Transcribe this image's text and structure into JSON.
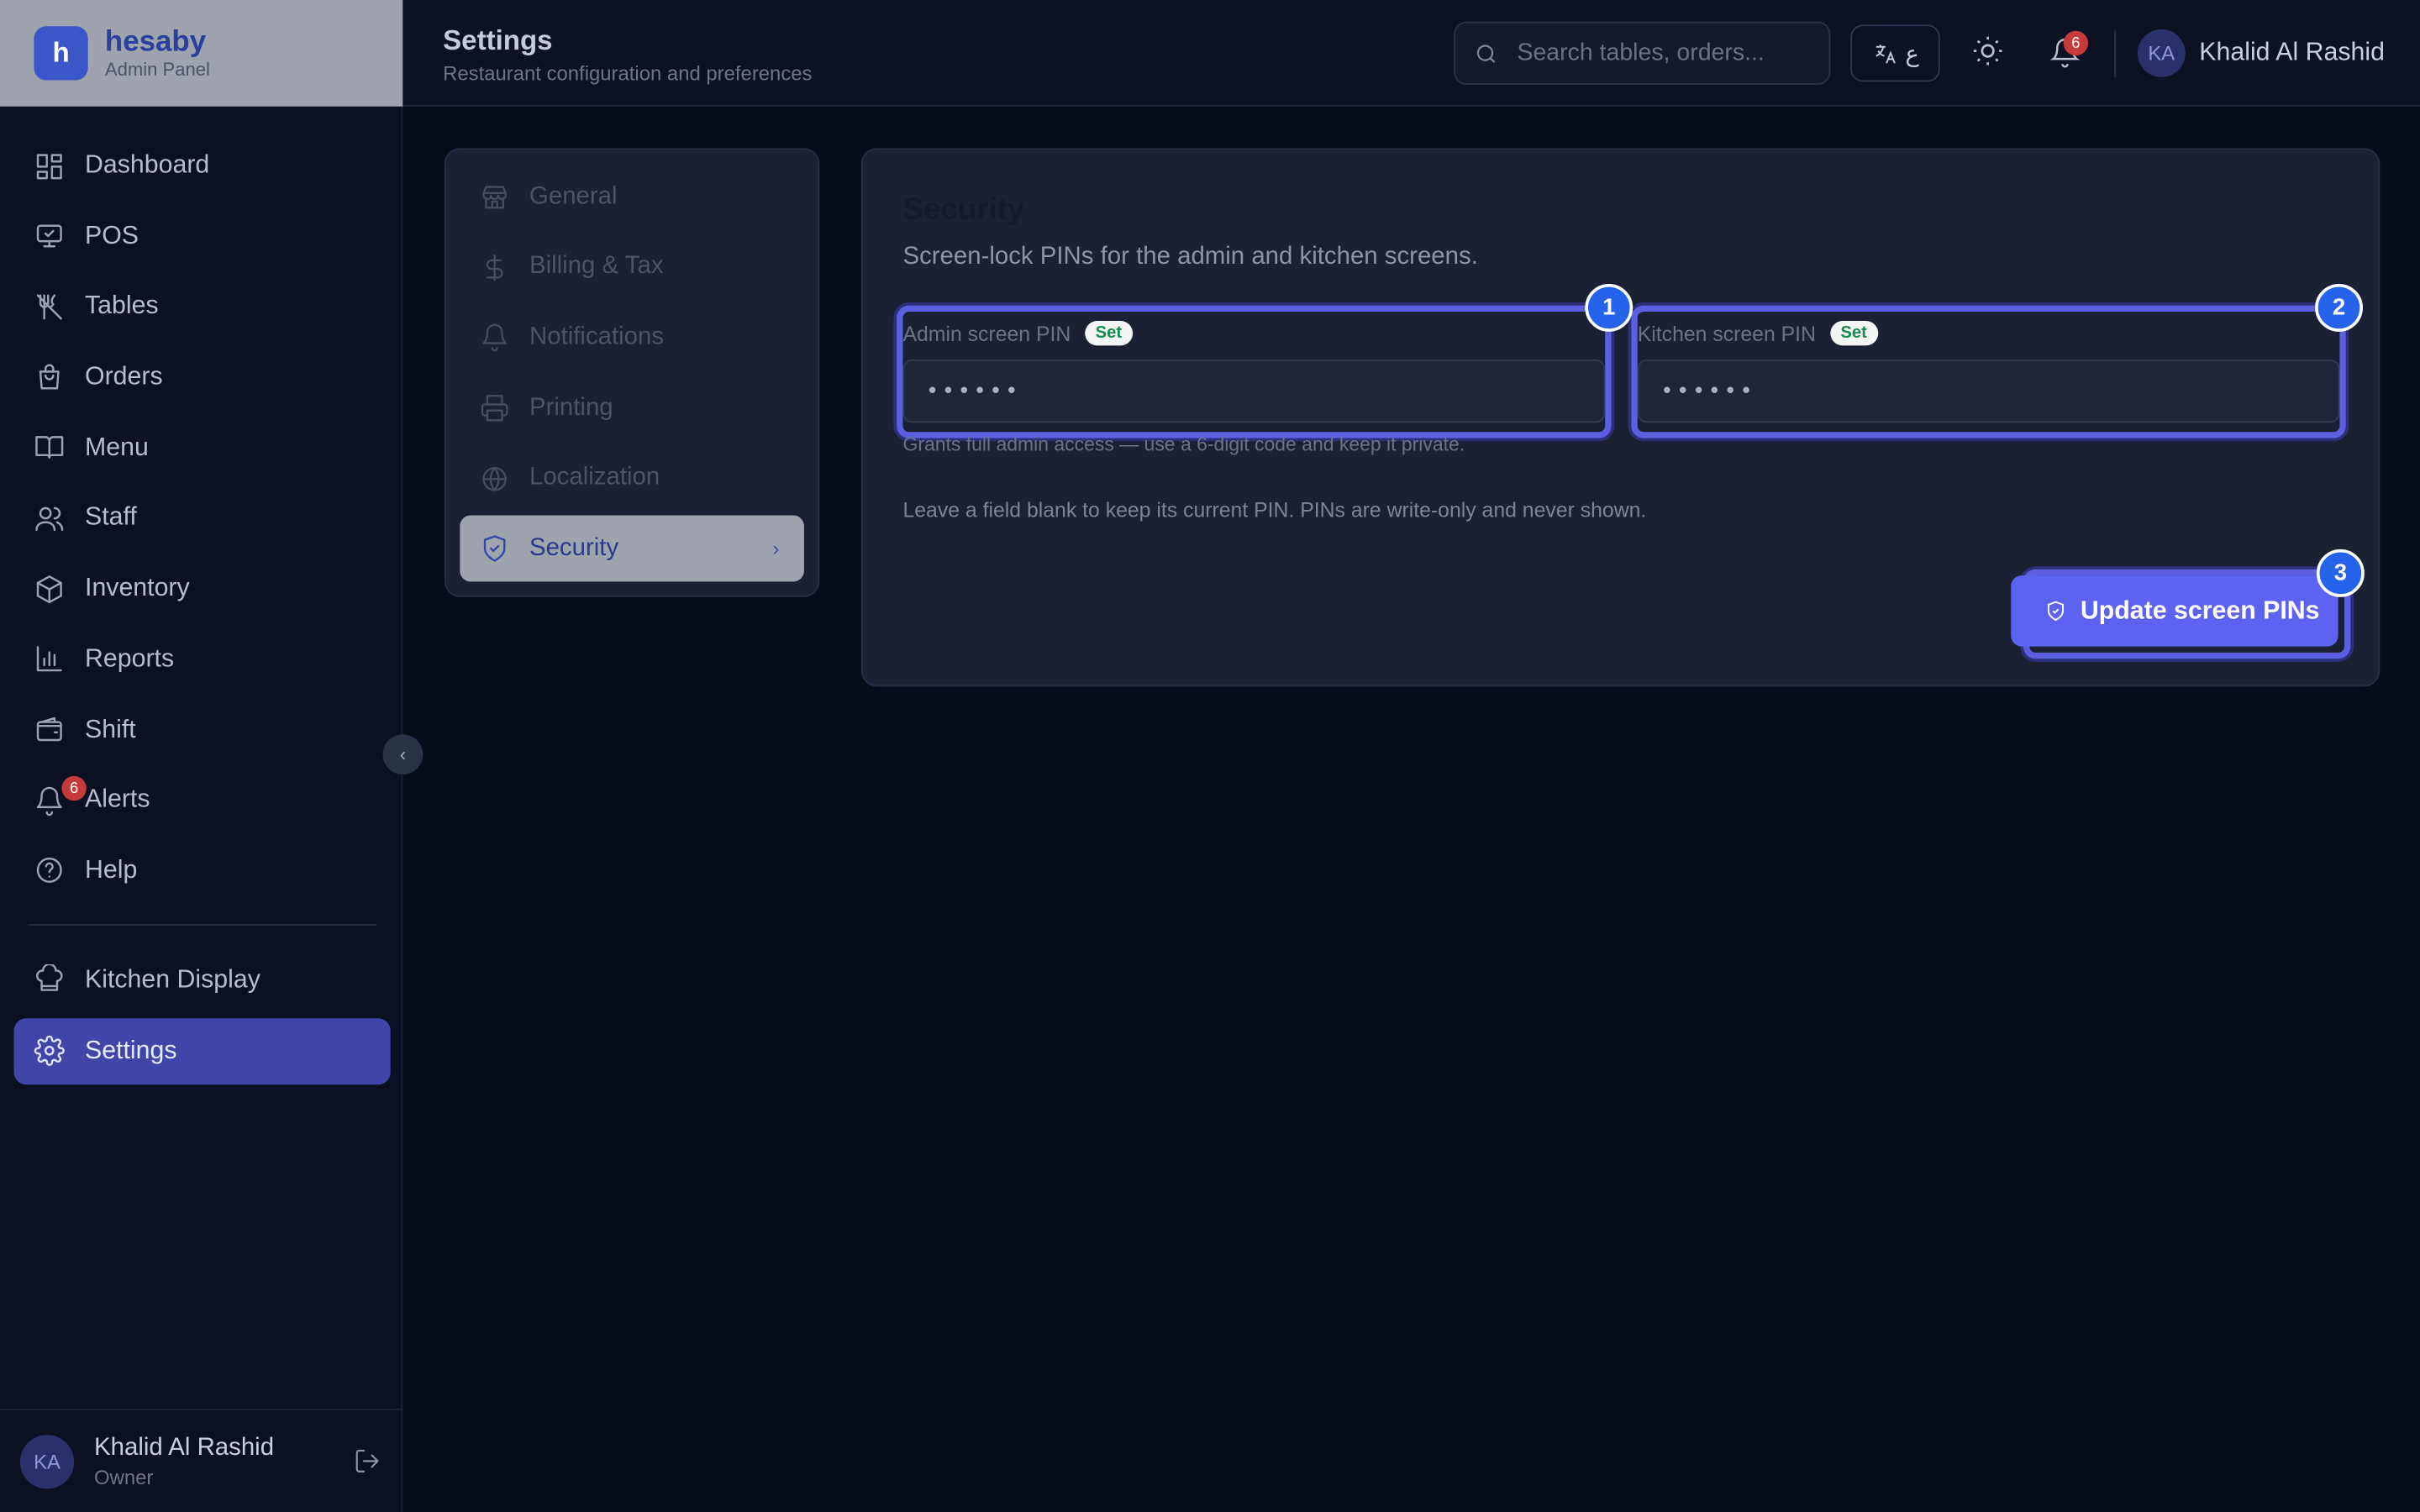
{
  "brand": {
    "letter": "h",
    "name": "hesaby",
    "subtitle": "Admin Panel"
  },
  "sidebar": {
    "items": [
      {
        "label": "Dashboard",
        "icon": "dashboard-icon"
      },
      {
        "label": "POS",
        "icon": "monitor-icon"
      },
      {
        "label": "Tables",
        "icon": "utensils-icon"
      },
      {
        "label": "Orders",
        "icon": "shopping-bag-icon"
      },
      {
        "label": "Menu",
        "icon": "book-icon"
      },
      {
        "label": "Staff",
        "icon": "users-icon"
      },
      {
        "label": "Inventory",
        "icon": "package-icon"
      },
      {
        "label": "Reports",
        "icon": "bar-chart-icon"
      },
      {
        "label": "Shift",
        "icon": "wallet-icon"
      },
      {
        "label": "Alerts",
        "icon": "bell-icon",
        "badge": "6"
      },
      {
        "label": "Help",
        "icon": "help-icon"
      }
    ],
    "bottom_items": [
      {
        "label": "Kitchen Display",
        "icon": "chef-hat-icon"
      },
      {
        "label": "Settings",
        "icon": "gear-icon",
        "active": true
      }
    ],
    "collapse_icon": "chevron-left-icon",
    "user": {
      "initials": "KA",
      "name": "Khalid Al Rashid",
      "role": "Owner"
    }
  },
  "header": {
    "title": "Settings",
    "subtitle": "Restaurant configuration and preferences",
    "search_placeholder": "Search tables, orders...",
    "lang_label": "ع",
    "notifications_count": "6",
    "user": {
      "initials": "KA",
      "name": "Khalid Al Rashid"
    }
  },
  "settings_nav": {
    "items": [
      {
        "label": "General",
        "icon": "store-icon"
      },
      {
        "label": "Billing & Tax",
        "icon": "dollar-icon"
      },
      {
        "label": "Notifications",
        "icon": "bell-icon"
      },
      {
        "label": "Printing",
        "icon": "printer-icon"
      },
      {
        "label": "Localization",
        "icon": "globe-icon"
      },
      {
        "label": "Security",
        "icon": "shield-icon",
        "active": true
      }
    ]
  },
  "security": {
    "title": "Security",
    "description": "Screen-lock PINs for the admin and kitchen screens.",
    "admin_pin": {
      "label": "Admin screen PIN",
      "badge": "Set",
      "value": "••••••",
      "hint": "Grants full admin access — use a 6-digit code and keep it private."
    },
    "kitchen_pin": {
      "label": "Kitchen screen PIN",
      "badge": "Set",
      "value": "••••••"
    },
    "note": "Leave a field blank to keep its current PIN. PINs are write-only and never shown.",
    "update_button": "Update screen PINs"
  },
  "markers": [
    "1",
    "2",
    "3"
  ],
  "colors": {
    "accent": "#5b63f0",
    "active_nav": "#4046a8",
    "marker": "#2563eb",
    "badge_red": "#c53a3a",
    "set_green": "#1a8a4e"
  }
}
